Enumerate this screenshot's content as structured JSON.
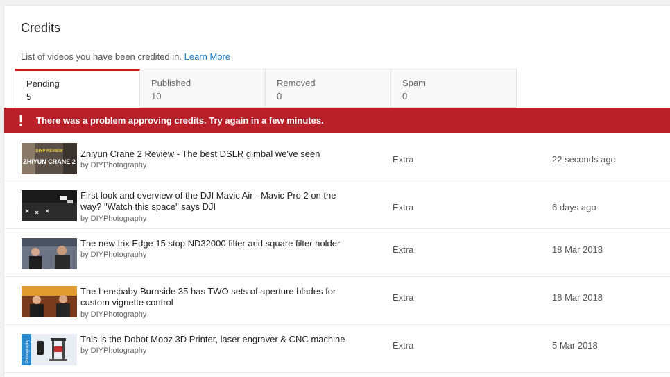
{
  "header": {
    "title": "Credits",
    "description": "List of videos you have been credited in.",
    "learn_more": "Learn More"
  },
  "tabs": [
    {
      "label": "Pending",
      "count": "5",
      "active": true
    },
    {
      "label": "Published",
      "count": "10",
      "active": false
    },
    {
      "label": "Removed",
      "count": "0",
      "active": false
    },
    {
      "label": "Spam",
      "count": "0",
      "active": false
    }
  ],
  "alert": {
    "icon": "exclamation-icon",
    "message": "There was a problem approving credits. Try again in a few minutes.",
    "color": "#b8202a"
  },
  "videos": [
    {
      "title": "Zhiyun Crane 2 Review - The best DSLR gimbal we've seen",
      "channel": "by DIYPhotography",
      "role": "Extra",
      "date": "22 seconds ago",
      "thumb_text_top": "DIYP REVIEW",
      "thumb_text": "ZHIYUN CRANE 2"
    },
    {
      "title": "First look and overview of the DJI Mavic Air - Mavic Pro 2 on the way? \"Watch this space\" says DJI",
      "channel": "by DIYPhotography",
      "role": "Extra",
      "date": "6 days ago"
    },
    {
      "title": "The new Irix Edge 15 stop ND32000 filter and square filter holder",
      "channel": "by DIYPhotography",
      "role": "Extra",
      "date": "18 Mar 2018"
    },
    {
      "title": "The Lensbaby Burnside 35 has TWO sets of aperture blades for custom vignette control",
      "channel": "by DIYPhotography",
      "role": "Extra",
      "date": "18 Mar 2018"
    },
    {
      "title": "This is the Dobot Mooz 3D Printer, laser engraver & CNC machine",
      "channel": "by DIYPhotography",
      "role": "Extra",
      "date": "5 Mar 2018",
      "thumb_text": "Photography"
    }
  ]
}
